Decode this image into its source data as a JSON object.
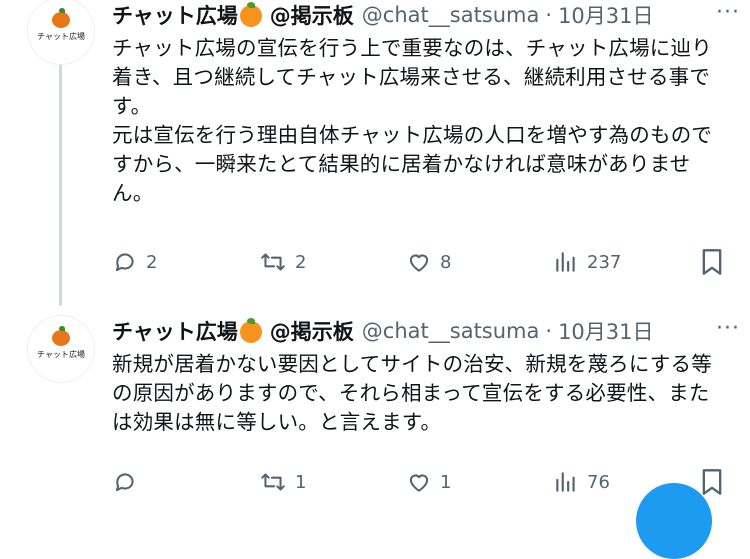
{
  "tweets": [
    {
      "display_name": "チャット広場",
      "label": "@掲示板",
      "handle": "@chat__satsuma",
      "separator": "·",
      "date": "10月31日",
      "avatar_text": "チャット広場",
      "more_glyph": "···",
      "body": [
        "チャット広場の宣伝を行う上で重要なのは、チャット広場に辿り着き、且つ継続してチャット広場来させる、継続利用させる事です。",
        "元は宣伝を行う理由自体チャット広場の人口を増やす為のものですから、一瞬来たとて結果的に居着かなければ意味がありません。"
      ],
      "replies": "2",
      "retweets": "2",
      "likes": "8",
      "views": "237"
    },
    {
      "display_name": "チャット広場",
      "label": "@掲示板",
      "handle": "@chat__satsuma",
      "separator": "·",
      "date": "10月31日",
      "avatar_text": "チャット広場",
      "more_glyph": "···",
      "body": [
        "新規が居着かない要因としてサイトの治安、新規を蔑ろにする等の原因がありますので、それら相まって宣伝をする必要性、または効果は無に等しい。と言えます。"
      ],
      "replies": "",
      "retweets": "1",
      "likes": "1",
      "views": "76"
    }
  ],
  "icons": {
    "reply": "reply-icon",
    "retweet": "retweet-icon",
    "like": "like-icon",
    "views": "views-icon",
    "bookmark": "bookmark-icon",
    "more": "more-icon"
  },
  "colors": {
    "text": "#0f1419",
    "secondary": "#536471",
    "thread_line": "#cfd9de",
    "accent": "#1d9bf0",
    "orange": "#f7931e"
  }
}
